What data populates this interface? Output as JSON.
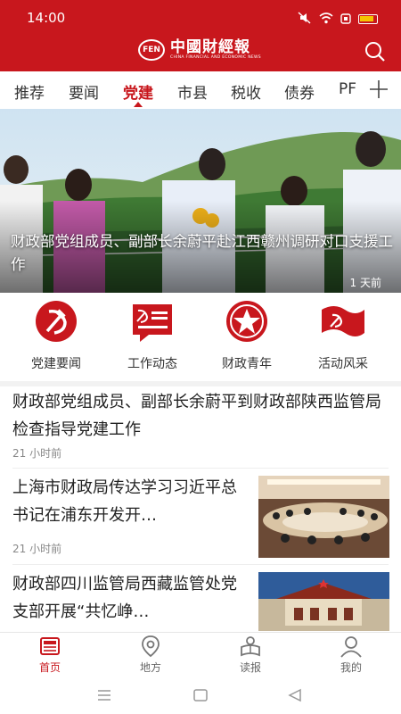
{
  "status": {
    "time": "14:00"
  },
  "header": {
    "logo_name": "中國財經報",
    "logo_sub": "CHINA FINANCIAL AND ECONOMIC NEWS",
    "logo_mark": "FEN"
  },
  "tabs": [
    {
      "label": "推荐"
    },
    {
      "label": "要闻"
    },
    {
      "label": "党建"
    },
    {
      "label": "市县"
    },
    {
      "label": "税收"
    },
    {
      "label": "债券"
    },
    {
      "label": "PF"
    }
  ],
  "active_tab": "党建",
  "hero": {
    "title": "财政部党组成员、副部长余蔚平赴江西赣州调研对口支援工作",
    "time": "1 天前"
  },
  "categories": [
    {
      "label": "党建要闻",
      "icon": "hammer-sickle-circle-icon"
    },
    {
      "label": "工作动态",
      "icon": "hammer-sickle-document-icon"
    },
    {
      "label": "财政青年",
      "icon": "star-circle-icon"
    },
    {
      "label": "活动风采",
      "icon": "party-flag-icon"
    }
  ],
  "news": [
    {
      "title": "财政部党组成员、副部长余蔚平到财政部陕西监管局检查指导党建工作",
      "time": "21 小时前"
    },
    {
      "title": "上海市财政局传达学习习近平总书记在浦东开发开…",
      "time": "21 小时前"
    },
    {
      "title": "财政部四川监管局西藏监管处党支部开展“共忆峥…",
      "time": ""
    }
  ],
  "bottom_nav": [
    {
      "label": "首页",
      "icon": "news-icon"
    },
    {
      "label": "地方",
      "icon": "location-icon"
    },
    {
      "label": "读报",
      "icon": "reader-icon"
    },
    {
      "label": "我的",
      "icon": "user-icon"
    }
  ],
  "colors": {
    "brand": "#c8171d",
    "text": "#222222",
    "muted": "#888888"
  }
}
